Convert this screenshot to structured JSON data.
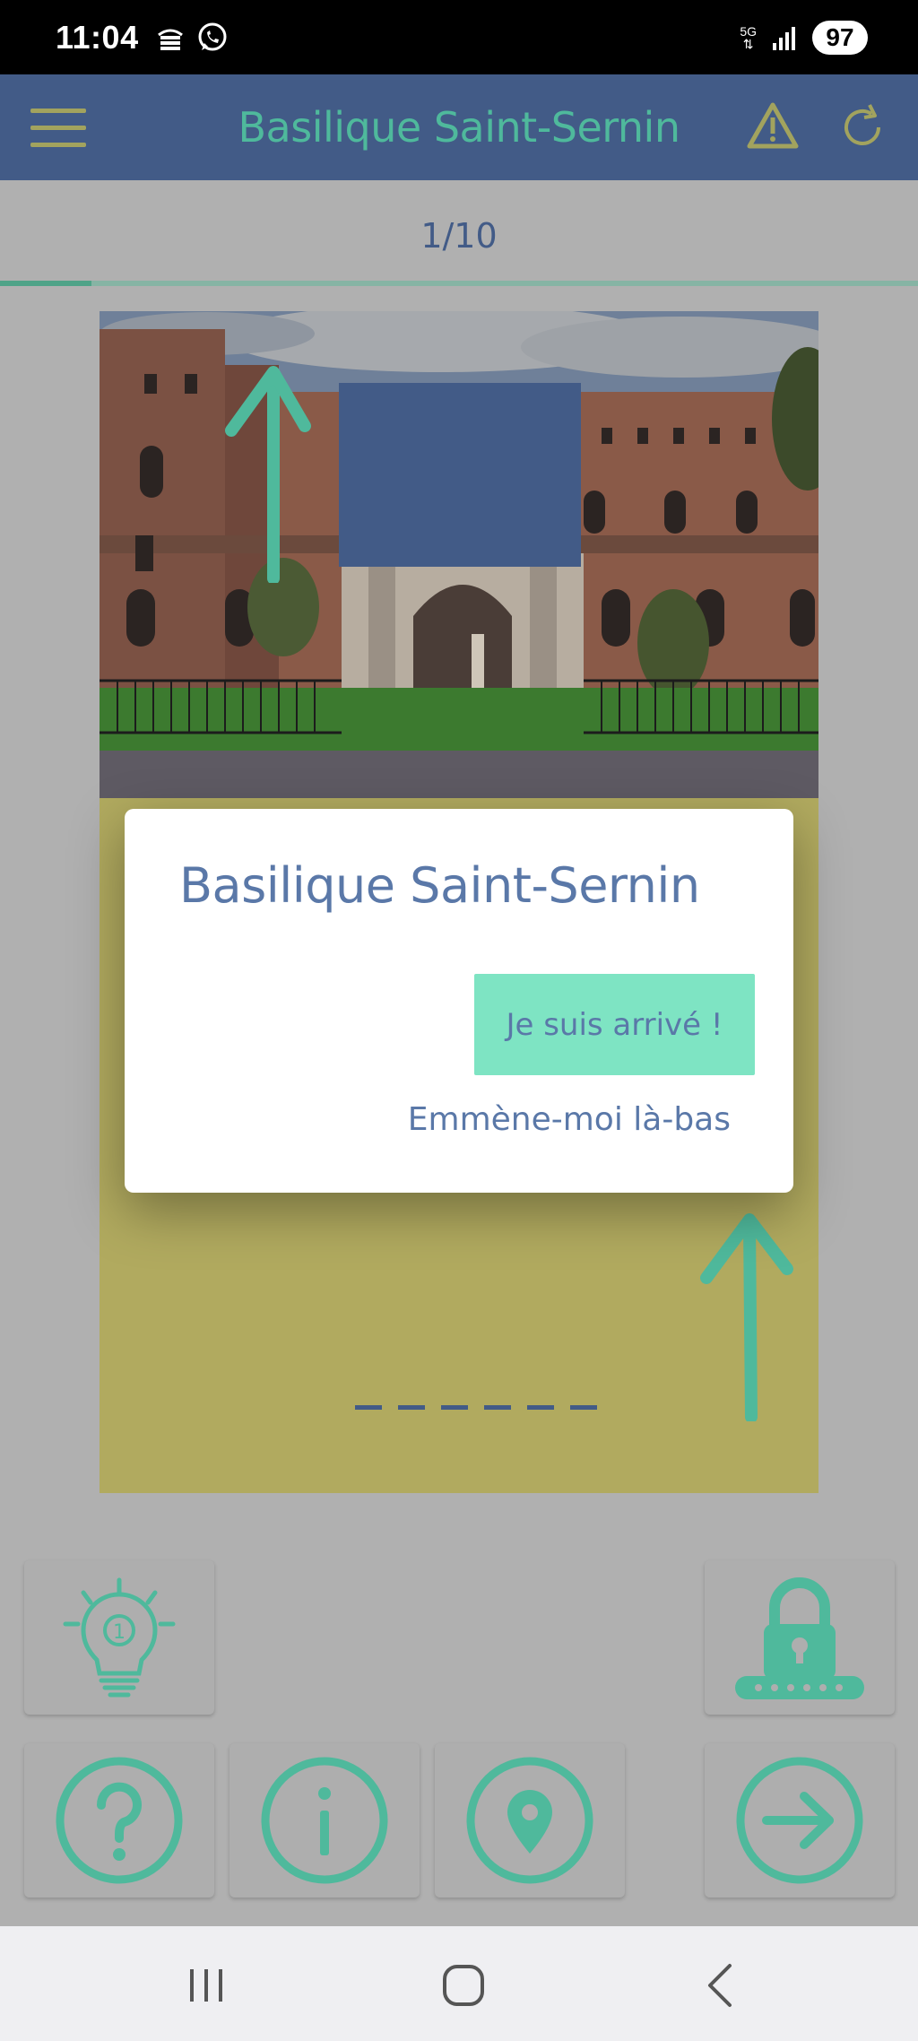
{
  "status_bar": {
    "time": "11:04",
    "network": "5G",
    "battery": "97"
  },
  "header": {
    "title": "Basilique Saint-Sernin",
    "icons": [
      "menu-icon",
      "warning-icon",
      "refresh-icon"
    ]
  },
  "progress": {
    "label": "1/10",
    "fraction": 0.1
  },
  "dialog": {
    "title": "Basilique Saint-Sernin",
    "arrive_button": "Je suis arrivé !",
    "lead_link": "Emmène-moi là-bas"
  },
  "tiles": {
    "hint_count": "1",
    "icons": [
      "hint-bulb-icon",
      "lock-code-icon",
      "help-icon",
      "info-icon",
      "location-pin-icon",
      "next-arrow-icon"
    ]
  },
  "colors": {
    "header_bg": "#425b87",
    "accent_teal": "#4fb99c",
    "card_bg": "#b1aa5f",
    "button_bg": "#7ee4c3",
    "text_blue": "#5a78a8",
    "overlay_bg": "#b0b0b0"
  }
}
